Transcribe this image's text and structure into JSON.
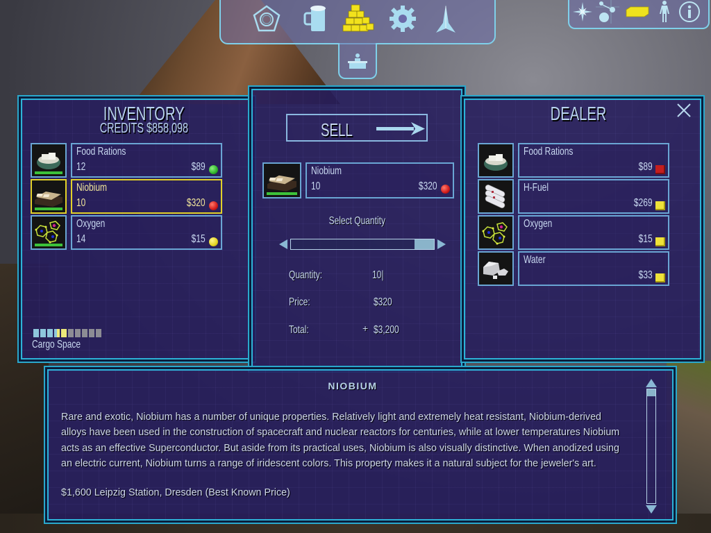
{
  "top_nav": {
    "items": [
      {
        "name": "tactical-icon",
        "label": "Pentagon"
      },
      {
        "name": "bar-icon",
        "label": "Mug"
      },
      {
        "name": "trade-icon",
        "label": "Gold Bars",
        "active": true
      },
      {
        "name": "equipment-icon",
        "label": "Gear"
      },
      {
        "name": "ship-icon",
        "label": "Ship"
      }
    ],
    "sub_item": {
      "name": "commodity-exchange-icon"
    }
  },
  "top_right": {
    "items": [
      {
        "name": "star-map-icon"
      },
      {
        "name": "system-map-icon"
      },
      {
        "name": "cargo-icon"
      },
      {
        "name": "character-icon"
      },
      {
        "name": "info-icon"
      }
    ]
  },
  "inventory": {
    "title": "INVENTORY",
    "credits": "CREDITS $858,098",
    "items": [
      {
        "name": "Food Rations",
        "qty": "12",
        "price": "$89",
        "indicator_color": "#2fb52b",
        "indicator": "green"
      },
      {
        "name": "Niobium",
        "qty": "10",
        "price": "$320",
        "indicator_color": "#d11b1b",
        "indicator": "red",
        "selected": true
      },
      {
        "name": "Oxygen",
        "qty": "14",
        "price": "$15",
        "indicator_color": "#e3d320",
        "indicator": "yellow"
      }
    ],
    "cargo_label": "Cargo Space",
    "cargo_slots_total": 10,
    "cargo_slots_used": 4,
    "cargo_slots_pending": 1
  },
  "trade": {
    "action_label": "SELL",
    "item": {
      "name": "Niobium",
      "qty": "10",
      "price": "$320",
      "indicator_color": "#d11b1b"
    },
    "select_quantity_label": "Select Quantity",
    "slider_fraction": 1.0,
    "quantity_label": "Quantity:",
    "quantity_value": "10|",
    "price_label": "Price:",
    "price_value": "$320",
    "total_label": "Total:",
    "total_sign": "+",
    "total_value": "$3,200"
  },
  "dealer": {
    "title": "DEALER",
    "items": [
      {
        "name": "Food Rations",
        "price": "$89",
        "indicator_color": "#c41e1e"
      },
      {
        "name": "H-Fuel",
        "price": "$269",
        "indicator_color": "#eee23a"
      },
      {
        "name": "Oxygen",
        "price": "$15",
        "indicator_color": "#eee23a"
      },
      {
        "name": "Water",
        "price": "$33",
        "indicator_color": "#eee23a"
      }
    ]
  },
  "description": {
    "title": "NIOBIUM",
    "body": "Rare and exotic, Niobium has a number of unique properties. Relatively light and extremely heat resistant, Niobium-derived alloys have been used in the construction of spacecraft and nuclear reactors for centuries, while at lower temperatures Niobium acts as an effective Superconductor. But aside from its practical uses, Niobium is also visually distinctive. When anodized using an electric current, Niobium turns a range of iridescent colors. This property makes it a natural subject for the jeweler's art.",
    "best_price": "$1,600 Leipzig Station, Dresden (Best Known Price)",
    "scroll_fraction": 0.0
  }
}
